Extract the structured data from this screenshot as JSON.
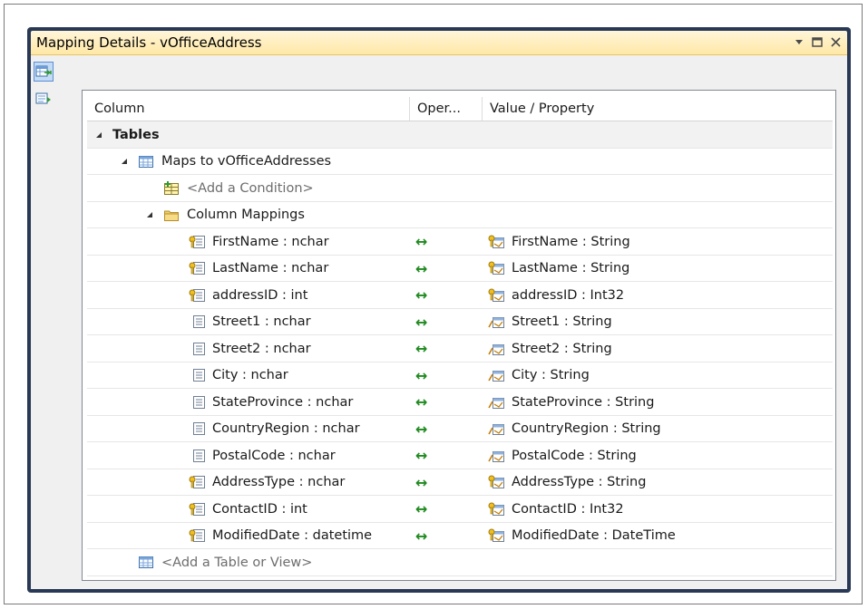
{
  "window": {
    "title": "Mapping Details - vOfficeAddress"
  },
  "grid": {
    "headers": {
      "column": "Column",
      "operator": "Oper...",
      "value": "Value / Property"
    },
    "tables_label": "Tables",
    "maps_to_label": "Maps to vOfficeAddresses",
    "add_condition_label": "<Add a Condition>",
    "column_mappings_label": "Column Mappings",
    "add_table_label": "<Add a Table or View>",
    "mappings": [
      {
        "column": "FirstName : nchar",
        "operator": "↔",
        "property": "FirstName : String",
        "key": true
      },
      {
        "column": "LastName : nchar",
        "operator": "↔",
        "property": "LastName : String",
        "key": true
      },
      {
        "column": "addressID : int",
        "operator": "↔",
        "property": "addressID : Int32",
        "key": true
      },
      {
        "column": "Street1 : nchar",
        "operator": "↔",
        "property": "Street1 : String",
        "key": false
      },
      {
        "column": "Street2 : nchar",
        "operator": "↔",
        "property": "Street2 : String",
        "key": false
      },
      {
        "column": "City : nchar",
        "operator": "↔",
        "property": "City : String",
        "key": false
      },
      {
        "column": "StateProvince : nchar",
        "operator": "↔",
        "property": "StateProvince : String",
        "key": false
      },
      {
        "column": "CountryRegion : nchar",
        "operator": "↔",
        "property": "CountryRegion : String",
        "key": false
      },
      {
        "column": "PostalCode : nchar",
        "operator": "↔",
        "property": "PostalCode : String",
        "key": false
      },
      {
        "column": "AddressType : nchar",
        "operator": "↔",
        "property": "AddressType : String",
        "key": true
      },
      {
        "column": "ContactID : int",
        "operator": "↔",
        "property": "ContactID : Int32",
        "key": true
      },
      {
        "column": "ModifiedDate : datetime",
        "operator": "↔",
        "property": "ModifiedDate : DateTime",
        "key": true
      }
    ]
  },
  "colors": {
    "frame": "#293955",
    "titlebar": "#ffe8a6",
    "arrow": "#1f8a1f"
  }
}
